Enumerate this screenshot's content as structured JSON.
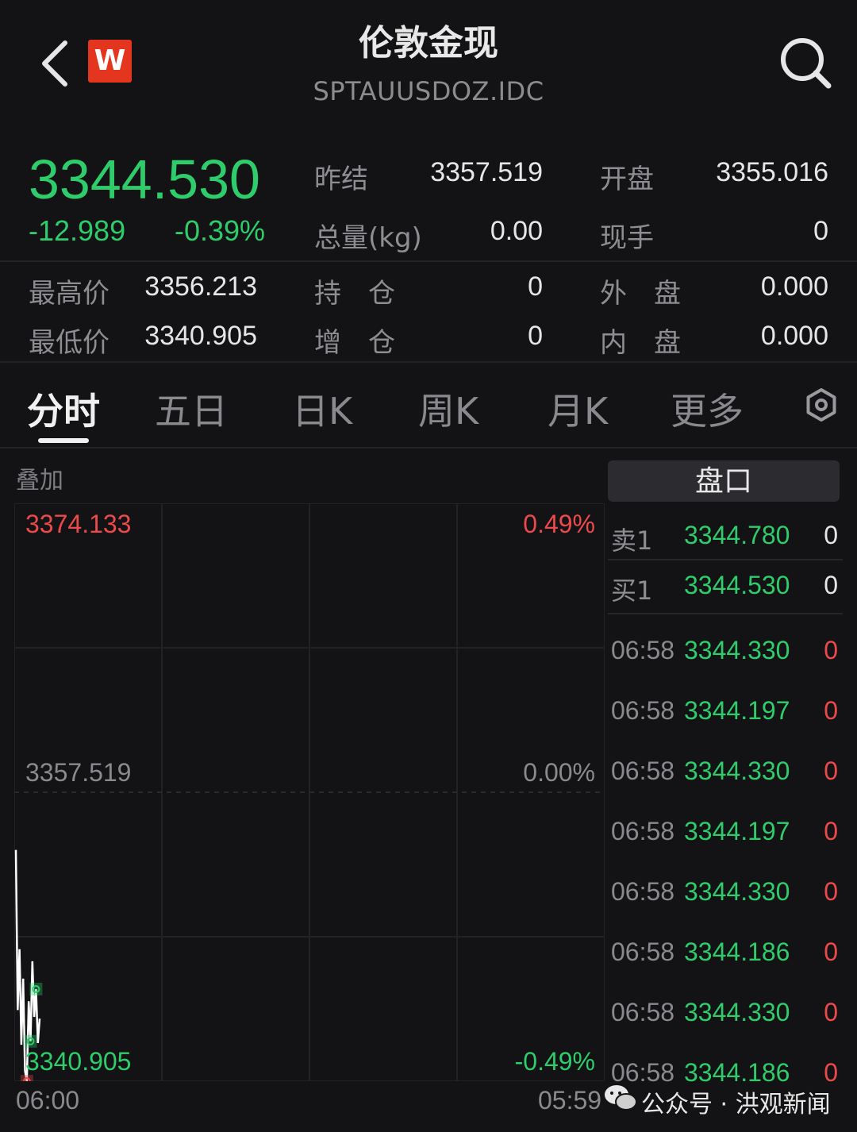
{
  "header": {
    "title": "伦敦金现",
    "subtitle": "SPTAUUSDOZ.IDC",
    "logo_text": "W",
    "back_icon": "chevron-left-icon",
    "search_icon": "search-icon"
  },
  "quote": {
    "price": "3344.530",
    "change": "-12.989",
    "change_pct": "-0.39%",
    "fields": {
      "prev_settle_label": "昨结",
      "prev_settle": "3357.519",
      "open_label": "开盘",
      "open": "3355.016",
      "volume_label": "总量(kg)",
      "volume": "0.00",
      "last_vol_label": "现手",
      "last_vol": "0",
      "high_label": "最高价",
      "high": "3356.213",
      "position_label": "持　仓",
      "position": "0",
      "outer_label": "外　盘",
      "outer": "0.000",
      "low_label": "最低价",
      "low": "3340.905",
      "add_pos_label": "增　仓",
      "add_pos": "0",
      "inner_label": "内　盘",
      "inner": "0.000"
    }
  },
  "tabs": [
    "分时",
    "五日",
    "日K",
    "周K",
    "月K",
    "更多"
  ],
  "active_tab": 0,
  "chart": {
    "overlay_label": "叠加",
    "top_price": "3374.133",
    "top_pct": "0.49%",
    "mid_price": "3357.519",
    "mid_pct": "0.00%",
    "bottom_price": "3340.905",
    "bottom_pct": "-0.49%",
    "time_start": "06:00",
    "time_end": "05:59"
  },
  "chart_data": {
    "type": "line",
    "ylim": [
      3340.905,
      3374.133
    ],
    "baseline": 3357.519,
    "x_range": [
      "06:00",
      "05:59"
    ],
    "series": [
      {
        "values": [
          3354.2,
          3345.0,
          3348.5,
          3343.0,
          3346.8,
          3341.5,
          3340.9,
          3345.5,
          3343.2,
          3347.8,
          3344.6,
          3346.2,
          3343.1,
          3344.5
        ]
      }
    ],
    "colors": {
      "line": "#ffffff",
      "up": "#ec4a4a",
      "down": "#2fcc6b",
      "grid": "#222226"
    }
  },
  "orderbook": {
    "title": "盘口",
    "ask_label": "卖1",
    "ask_price": "3344.780",
    "ask_vol": "0",
    "bid_label": "买1",
    "bid_price": "3344.530",
    "bid_vol": "0"
  },
  "ticks": [
    {
      "time": "06:58",
      "price": "3344.330",
      "vol": "0"
    },
    {
      "time": "06:58",
      "price": "3344.197",
      "vol": "0"
    },
    {
      "time": "06:58",
      "price": "3344.330",
      "vol": "0"
    },
    {
      "time": "06:58",
      "price": "3344.197",
      "vol": "0"
    },
    {
      "time": "06:58",
      "price": "3344.330",
      "vol": "0"
    },
    {
      "time": "06:58",
      "price": "3344.186",
      "vol": "0"
    },
    {
      "time": "06:58",
      "price": "3344.330",
      "vol": "0"
    },
    {
      "time": "06:58",
      "price": "3344.186",
      "vol": "0"
    }
  ],
  "watermark": "公众号 · 洪观新闻",
  "colors": {
    "bg": "#131315",
    "green": "#2fcc6b",
    "red": "#ec4a4a",
    "logo": "#e4361f"
  }
}
